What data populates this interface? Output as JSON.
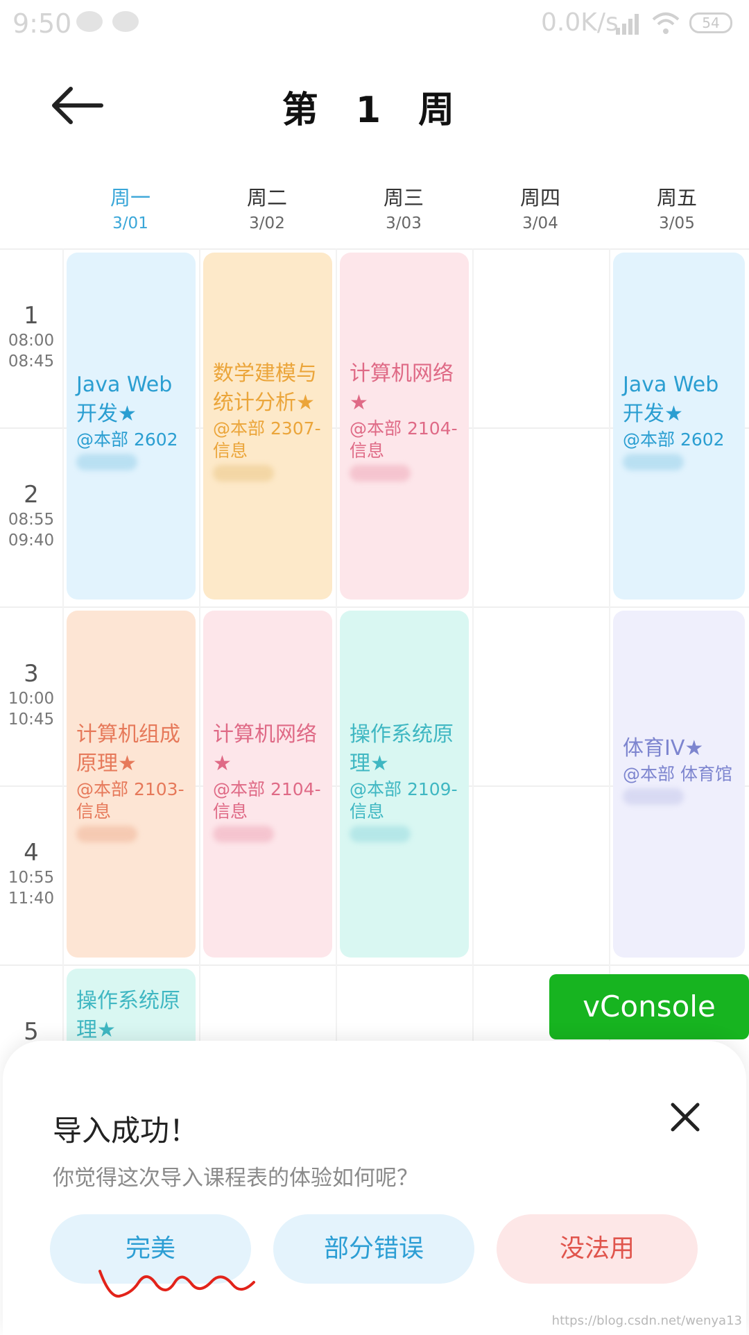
{
  "status_bar": {
    "time": "9:50",
    "net_speed": "0.0K/s",
    "battery": "54"
  },
  "header": {
    "title": "第 1 周"
  },
  "days": [
    {
      "name": "周一",
      "date": "3/01",
      "active": true
    },
    {
      "name": "周二",
      "date": "3/02",
      "active": false
    },
    {
      "name": "周三",
      "date": "3/03",
      "active": false
    },
    {
      "name": "周四",
      "date": "3/04",
      "active": false
    },
    {
      "name": "周五",
      "date": "3/05",
      "active": false
    }
  ],
  "periods": [
    {
      "num": "1",
      "start": "08:00",
      "end": "08:45"
    },
    {
      "num": "2",
      "start": "08:55",
      "end": "09:40"
    },
    {
      "num": "3",
      "start": "10:00",
      "end": "10:45"
    },
    {
      "num": "4",
      "start": "10:55",
      "end": "11:40"
    },
    {
      "num": "5",
      "start": "",
      "end": ""
    }
  ],
  "courses": {
    "mon_am": {
      "name": "Java Web开发★",
      "room": "@本部 2602"
    },
    "tue_am": {
      "name": "数学建模与统计分析★",
      "room": "@本部 2307-信息"
    },
    "wed_am": {
      "name": "计算机网络★",
      "room": "@本部 2104-信息"
    },
    "fri_am": {
      "name": "Java Web开发★",
      "room": "@本部 2602"
    },
    "mon_mid": {
      "name": "计算机组成原理★",
      "room": "@本部 2103-信息"
    },
    "tue_mid": {
      "name": "计算机网络★",
      "room": "@本部 2104-信息"
    },
    "wed_mid": {
      "name": "操作系统原理★",
      "room": "@本部 2109-信息"
    },
    "fri_mid": {
      "name": "体育IV★",
      "room": "@本部 体育馆"
    },
    "mon_p5": {
      "name": "操作系统原理★",
      "room": ""
    }
  },
  "vconsole": {
    "label": "vConsole"
  },
  "sheet": {
    "title": "导入成功！",
    "subtitle": "你觉得这次导入课程表的体验如何呢？",
    "buttons": {
      "perfect": "完美",
      "partial": "部分错误",
      "unusable": "没法用"
    }
  },
  "watermark": "https://blog.csdn.net/wenya13",
  "colors": {
    "accent": "#39a6d8",
    "vconsole": "#17b420"
  }
}
